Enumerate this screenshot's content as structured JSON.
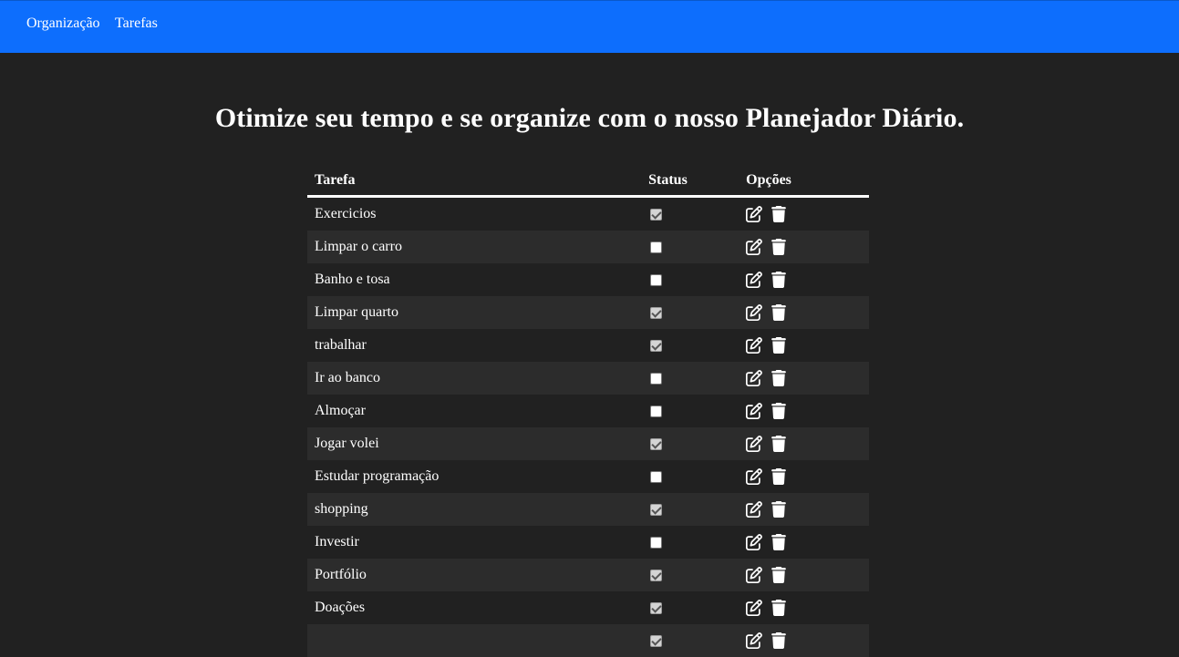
{
  "nav": {
    "items": [
      {
        "label": "Organização"
      },
      {
        "label": "Tarefas"
      }
    ]
  },
  "main": {
    "title": "Otimize seu tempo e se organize com o nosso Planejador Diário."
  },
  "table": {
    "headers": {
      "task": "Tarefa",
      "status": "Status",
      "options": "Opções"
    },
    "rows": [
      {
        "task": "Exercicios",
        "done": true
      },
      {
        "task": "Limpar o carro",
        "done": false
      },
      {
        "task": "Banho e tosa",
        "done": false
      },
      {
        "task": "Limpar quarto",
        "done": true
      },
      {
        "task": "trabalhar",
        "done": true
      },
      {
        "task": "Ir ao banco",
        "done": false
      },
      {
        "task": "Almoçar",
        "done": false
      },
      {
        "task": "Jogar volei",
        "done": true
      },
      {
        "task": "Estudar programação",
        "done": false
      },
      {
        "task": "shopping",
        "done": true
      },
      {
        "task": "Investir",
        "done": false
      },
      {
        "task": "Portfólio",
        "done": true
      },
      {
        "task": "Doações",
        "done": true
      },
      {
        "task": "",
        "done": true
      }
    ]
  },
  "colors": {
    "navbar": "#0d6efd",
    "background": "#212121",
    "row_alt": "#2c2c2c",
    "text": "#ffffff"
  },
  "icons": {
    "edit": "edit-icon",
    "delete": "trash-icon"
  }
}
